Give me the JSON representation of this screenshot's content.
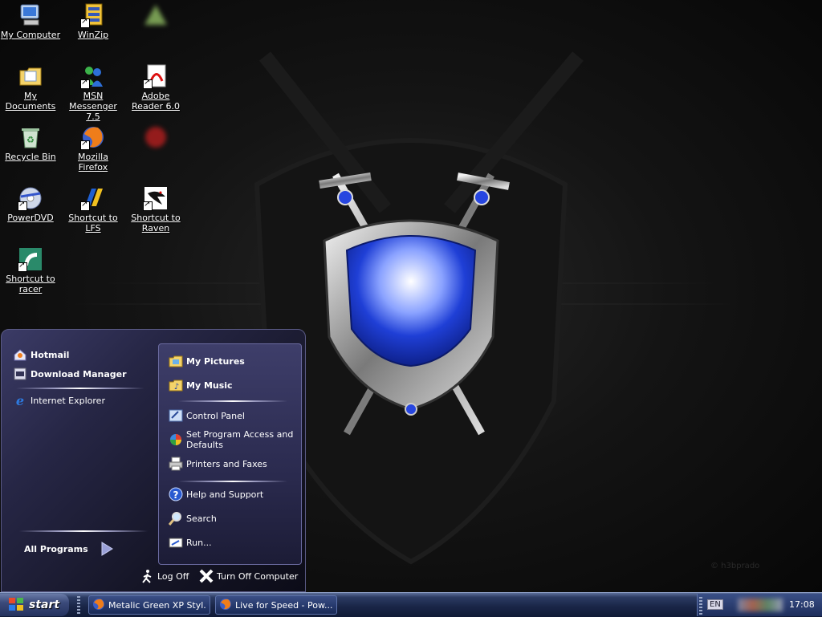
{
  "desktop": {
    "icons": [
      {
        "label": "My Computer",
        "icon": "computer-icon"
      },
      {
        "label": "WinZip",
        "icon": "winzip-icon"
      },
      {
        "label": "",
        "icon": "blurred-icon"
      },
      {
        "label": "My Documents",
        "icon": "folder-documents-icon"
      },
      {
        "label": "MSN Messenger 7.5",
        "icon": "msn-messenger-icon"
      },
      {
        "label": "Adobe Reader 6.0",
        "icon": "adobe-reader-icon"
      },
      {
        "label": "Recycle Bin",
        "icon": "recycle-bin-icon"
      },
      {
        "label": "Mozilla Firefox",
        "icon": "firefox-icon"
      },
      {
        "label": "",
        "icon": "blurred-icon"
      },
      {
        "label": "PowerDVD",
        "icon": "powerdvd-icon"
      },
      {
        "label": "Shortcut to LFS",
        "icon": "lfs-icon"
      },
      {
        "label": "Shortcut to Raven",
        "icon": "raven-icon"
      },
      {
        "label": "Shortcut to racer",
        "icon": "racer-icon"
      }
    ],
    "wallpaper_signature": "© h3bprado"
  },
  "start_menu": {
    "pinned": [
      {
        "label": "Hotmail",
        "icon": "hotmail-icon"
      },
      {
        "label": "Download Manager",
        "icon": "download-manager-icon"
      }
    ],
    "recent": [
      {
        "label": "Internet Explorer",
        "icon": "internet-explorer-icon"
      }
    ],
    "all_programs": "All Programs",
    "right_top": [
      {
        "label": "My Pictures",
        "icon": "my-pictures-icon"
      },
      {
        "label": "My Music",
        "icon": "my-music-icon"
      }
    ],
    "right_middle": [
      {
        "label": "Control Panel",
        "icon": "control-panel-icon"
      },
      {
        "label": "Set Program Access and Defaults",
        "icon": "program-access-icon"
      },
      {
        "label": "Printers and Faxes",
        "icon": "printer-icon"
      }
    ],
    "right_bottom": [
      {
        "label": "Help and Support",
        "icon": "help-icon"
      },
      {
        "label": "Search",
        "icon": "search-icon"
      },
      {
        "label": "Run...",
        "icon": "run-icon"
      }
    ],
    "footer": {
      "log_off": "Log Off",
      "turn_off": "Turn Off Computer"
    }
  },
  "taskbar": {
    "start_label": "start",
    "tasks": [
      {
        "label": "Metalic Green XP Styl...",
        "icon": "firefox-icon"
      },
      {
        "label": "Live for Speed - Pow...",
        "icon": "firefox-icon"
      }
    ],
    "tray": {
      "language": "EN",
      "clock": "17:08"
    }
  },
  "colors": {
    "shield_blue": "#1f3fd6",
    "taskbar_dark": "#1a2648",
    "start_menu_panel": "#2a2a4e"
  }
}
